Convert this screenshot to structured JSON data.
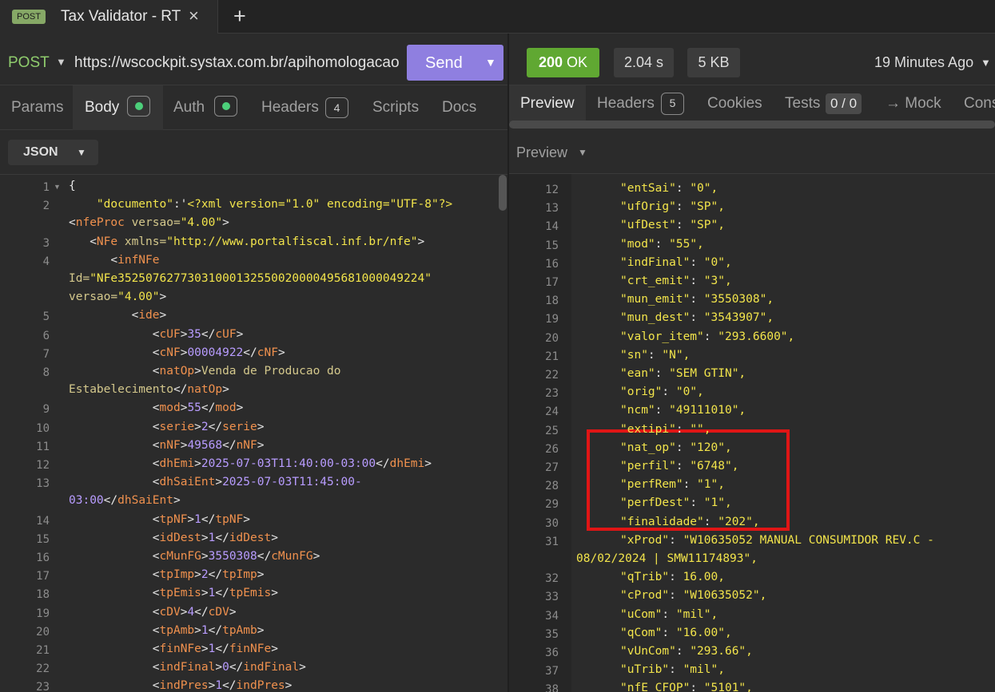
{
  "tab": {
    "method_badge": "POST",
    "title": "Tax Validator - RT",
    "close_icon": "×",
    "add_icon": "+"
  },
  "request": {
    "method": "POST",
    "url": "https://wscockpit.systax.com.br/apihomologacao",
    "send_label": "Send"
  },
  "request_tabs": {
    "params": "Params",
    "body": "Body",
    "auth": "Auth",
    "headers": "Headers",
    "headers_count": "4",
    "scripts": "Scripts",
    "docs": "Docs"
  },
  "body_format": "JSON",
  "editor_lines": [
    {
      "n": "1",
      "segs": [
        [
          "c-bracket",
          "{"
        ]
      ],
      "fold": true
    },
    {
      "n": "2",
      "segs": [
        [
          "c-prop",
          "    \"documento\""
        ],
        [
          "c-bracket",
          ":'"
        ],
        [
          "c-str",
          "<?xml version=\"1.0\" encoding=\"UTF-8\"?>"
        ]
      ]
    },
    {
      "n": "",
      "segs": [
        [
          "c-bracket",
          "<"
        ],
        [
          "c-tag",
          "nfeProc"
        ],
        [
          "c-attr",
          " versao="
        ],
        [
          "c-str",
          "\"4.00\""
        ],
        [
          "c-bracket",
          ">"
        ]
      ]
    },
    {
      "n": "3",
      "segs": [
        [
          "c-bracket",
          "   <"
        ],
        [
          "c-tag",
          "NFe"
        ],
        [
          "c-attr",
          " xmlns="
        ],
        [
          "c-str",
          "\"http://www.portalfiscal.inf.br/nfe\""
        ],
        [
          "c-bracket",
          ">"
        ]
      ]
    },
    {
      "n": "4",
      "segs": [
        [
          "c-bracket",
          "      <"
        ],
        [
          "c-tag",
          "infNFe"
        ]
      ]
    },
    {
      "n": "",
      "segs": [
        [
          "c-attr",
          "Id="
        ],
        [
          "c-str",
          "\"NFe35250762773031000132550020000495681000049224\""
        ]
      ]
    },
    {
      "n": "",
      "segs": [
        [
          "c-attr",
          "versao="
        ],
        [
          "c-str",
          "\"4.00\""
        ],
        [
          "c-bracket",
          ">"
        ]
      ]
    },
    {
      "n": "5",
      "segs": [
        [
          "c-bracket",
          "         <"
        ],
        [
          "c-tag",
          "ide"
        ],
        [
          "c-bracket",
          ">"
        ]
      ]
    },
    {
      "n": "6",
      "segs": [
        [
          "c-bracket",
          "            <"
        ],
        [
          "c-tag",
          "cUF"
        ],
        [
          "c-bracket",
          ">"
        ],
        [
          "c-num",
          "35"
        ],
        [
          "c-bracket",
          "</"
        ],
        [
          "c-tag",
          "cUF"
        ],
        [
          "c-bracket",
          ">"
        ]
      ]
    },
    {
      "n": "7",
      "segs": [
        [
          "c-bracket",
          "            <"
        ],
        [
          "c-tag",
          "cNF"
        ],
        [
          "c-bracket",
          ">"
        ],
        [
          "c-num",
          "00004922"
        ],
        [
          "c-bracket",
          "</"
        ],
        [
          "c-tag",
          "cNF"
        ],
        [
          "c-bracket",
          ">"
        ]
      ]
    },
    {
      "n": "8",
      "segs": [
        [
          "c-bracket",
          "            <"
        ],
        [
          "c-tag",
          "natOp"
        ],
        [
          "c-bracket",
          ">"
        ],
        [
          "c-attr",
          "Venda de Producao do"
        ]
      ]
    },
    {
      "n": "",
      "segs": [
        [
          "c-attr",
          "Estabelecimento"
        ],
        [
          "c-bracket",
          "</"
        ],
        [
          "c-tag",
          "natOp"
        ],
        [
          "c-bracket",
          ">"
        ]
      ]
    },
    {
      "n": "9",
      "segs": [
        [
          "c-bracket",
          "            <"
        ],
        [
          "c-tag",
          "mod"
        ],
        [
          "c-bracket",
          ">"
        ],
        [
          "c-num",
          "55"
        ],
        [
          "c-bracket",
          "</"
        ],
        [
          "c-tag",
          "mod"
        ],
        [
          "c-bracket",
          ">"
        ]
      ]
    },
    {
      "n": "10",
      "segs": [
        [
          "c-bracket",
          "            <"
        ],
        [
          "c-tag",
          "serie"
        ],
        [
          "c-bracket",
          ">"
        ],
        [
          "c-num",
          "2"
        ],
        [
          "c-bracket",
          "</"
        ],
        [
          "c-tag",
          "serie"
        ],
        [
          "c-bracket",
          ">"
        ]
      ]
    },
    {
      "n": "11",
      "segs": [
        [
          "c-bracket",
          "            <"
        ],
        [
          "c-tag",
          "nNF"
        ],
        [
          "c-bracket",
          ">"
        ],
        [
          "c-num",
          "49568"
        ],
        [
          "c-bracket",
          "</"
        ],
        [
          "c-tag",
          "nNF"
        ],
        [
          "c-bracket",
          ">"
        ]
      ]
    },
    {
      "n": "12",
      "segs": [
        [
          "c-bracket",
          "            <"
        ],
        [
          "c-tag",
          "dhEmi"
        ],
        [
          "c-bracket",
          ">"
        ],
        [
          "c-num",
          "2025-07-03T11:40:00-03:00"
        ],
        [
          "c-bracket",
          "</"
        ],
        [
          "c-tag",
          "dhEmi"
        ],
        [
          "c-bracket",
          ">"
        ]
      ]
    },
    {
      "n": "13",
      "segs": [
        [
          "c-bracket",
          "            <"
        ],
        [
          "c-tag",
          "dhSaiEnt"
        ],
        [
          "c-bracket",
          ">"
        ],
        [
          "c-num",
          "2025-07-03T11:45:00-"
        ]
      ]
    },
    {
      "n": "",
      "segs": [
        [
          "c-num",
          "03:00"
        ],
        [
          "c-bracket",
          "</"
        ],
        [
          "c-tag",
          "dhSaiEnt"
        ],
        [
          "c-bracket",
          ">"
        ]
      ]
    },
    {
      "n": "14",
      "segs": [
        [
          "c-bracket",
          "            <"
        ],
        [
          "c-tag",
          "tpNF"
        ],
        [
          "c-bracket",
          ">"
        ],
        [
          "c-num",
          "1"
        ],
        [
          "c-bracket",
          "</"
        ],
        [
          "c-tag",
          "tpNF"
        ],
        [
          "c-bracket",
          ">"
        ]
      ]
    },
    {
      "n": "15",
      "segs": [
        [
          "c-bracket",
          "            <"
        ],
        [
          "c-tag",
          "idDest"
        ],
        [
          "c-bracket",
          ">"
        ],
        [
          "c-num",
          "1"
        ],
        [
          "c-bracket",
          "</"
        ],
        [
          "c-tag",
          "idDest"
        ],
        [
          "c-bracket",
          ">"
        ]
      ]
    },
    {
      "n": "16",
      "segs": [
        [
          "c-bracket",
          "            <"
        ],
        [
          "c-tag",
          "cMunFG"
        ],
        [
          "c-bracket",
          ">"
        ],
        [
          "c-num",
          "3550308"
        ],
        [
          "c-bracket",
          "</"
        ],
        [
          "c-tag",
          "cMunFG"
        ],
        [
          "c-bracket",
          ">"
        ]
      ]
    },
    {
      "n": "17",
      "segs": [
        [
          "c-bracket",
          "            <"
        ],
        [
          "c-tag",
          "tpImp"
        ],
        [
          "c-bracket",
          ">"
        ],
        [
          "c-num",
          "2"
        ],
        [
          "c-bracket",
          "</"
        ],
        [
          "c-tag",
          "tpImp"
        ],
        [
          "c-bracket",
          ">"
        ]
      ]
    },
    {
      "n": "18",
      "segs": [
        [
          "c-bracket",
          "            <"
        ],
        [
          "c-tag",
          "tpEmis"
        ],
        [
          "c-bracket",
          ">"
        ],
        [
          "c-num",
          "1"
        ],
        [
          "c-bracket",
          "</"
        ],
        [
          "c-tag",
          "tpEmis"
        ],
        [
          "c-bracket",
          ">"
        ]
      ]
    },
    {
      "n": "19",
      "segs": [
        [
          "c-bracket",
          "            <"
        ],
        [
          "c-tag",
          "cDV"
        ],
        [
          "c-bracket",
          ">"
        ],
        [
          "c-num",
          "4"
        ],
        [
          "c-bracket",
          "</"
        ],
        [
          "c-tag",
          "cDV"
        ],
        [
          "c-bracket",
          ">"
        ]
      ]
    },
    {
      "n": "20",
      "segs": [
        [
          "c-bracket",
          "            <"
        ],
        [
          "c-tag",
          "tpAmb"
        ],
        [
          "c-bracket",
          ">"
        ],
        [
          "c-num",
          "1"
        ],
        [
          "c-bracket",
          "</"
        ],
        [
          "c-tag",
          "tpAmb"
        ],
        [
          "c-bracket",
          ">"
        ]
      ]
    },
    {
      "n": "21",
      "segs": [
        [
          "c-bracket",
          "            <"
        ],
        [
          "c-tag",
          "finNFe"
        ],
        [
          "c-bracket",
          ">"
        ],
        [
          "c-num",
          "1"
        ],
        [
          "c-bracket",
          "</"
        ],
        [
          "c-tag",
          "finNFe"
        ],
        [
          "c-bracket",
          ">"
        ]
      ]
    },
    {
      "n": "22",
      "segs": [
        [
          "c-bracket",
          "            <"
        ],
        [
          "c-tag",
          "indFinal"
        ],
        [
          "c-bracket",
          ">"
        ],
        [
          "c-num",
          "0"
        ],
        [
          "c-bracket",
          "</"
        ],
        [
          "c-tag",
          "indFinal"
        ],
        [
          "c-bracket",
          ">"
        ]
      ]
    },
    {
      "n": "23",
      "segs": [
        [
          "c-bracket",
          "            <"
        ],
        [
          "c-tag",
          "indPres"
        ],
        [
          "c-bracket",
          ">"
        ],
        [
          "c-num",
          "1"
        ],
        [
          "c-bracket",
          "</"
        ],
        [
          "c-tag",
          "indPres"
        ],
        [
          "c-bracket",
          ">"
        ]
      ]
    }
  ],
  "response": {
    "status": "200",
    "status_text": "OK",
    "time": "2.04 s",
    "size": "5 KB",
    "ago": "19 Minutes Ago"
  },
  "response_tabs": {
    "preview": "Preview",
    "headers": "Headers",
    "headers_count": "5",
    "cookies": "Cookies",
    "tests": "Tests",
    "tests_count": "0 / 0",
    "mock": "→ Mock",
    "console": "Cons"
  },
  "preview_mode": "Preview",
  "viewer_lines": [
    {
      "n": "12",
      "key": "entSai",
      "val": "\"0\","
    },
    {
      "n": "13",
      "key": "ufOrig",
      "val": "\"SP\","
    },
    {
      "n": "14",
      "key": "ufDest",
      "val": "\"SP\","
    },
    {
      "n": "15",
      "key": "mod",
      "val": "\"55\","
    },
    {
      "n": "16",
      "key": "indFinal",
      "val": "\"0\","
    },
    {
      "n": "17",
      "key": "crt_emit",
      "val": "\"3\","
    },
    {
      "n": "18",
      "key": "mun_emit",
      "val": "\"3550308\","
    },
    {
      "n": "19",
      "key": "mun_dest",
      "val": "\"3543907\","
    },
    {
      "n": "20",
      "key": "valor_item",
      "val": "\"293.6600\","
    },
    {
      "n": "21",
      "key": "sn",
      "val": "\"N\","
    },
    {
      "n": "22",
      "key": "ean",
      "val": "\"SEM GTIN\","
    },
    {
      "n": "23",
      "key": "orig",
      "val": "\"0\","
    },
    {
      "n": "24",
      "key": "ncm",
      "val": "\"49111010\","
    },
    {
      "n": "25",
      "key": "extipi",
      "val": "\"\","
    },
    {
      "n": "26",
      "key": "nat_op",
      "val": "\"120\","
    },
    {
      "n": "27",
      "key": "perfil",
      "val": "\"6748\","
    },
    {
      "n": "28",
      "key": "perfRem",
      "val": "\"1\","
    },
    {
      "n": "29",
      "key": "perfDest",
      "val": "\"1\","
    },
    {
      "n": "30",
      "key": "finalidade",
      "val": "\"202\","
    },
    {
      "n": "31",
      "key": "xProd",
      "val": "\"W10635052 MANUAL CONSUMIDOR REV.C -",
      "wrap": "08/02/2024 | SMW11174893\","
    },
    {
      "n": "32",
      "key": "qTrib",
      "val": "16.00,"
    },
    {
      "n": "33",
      "key": "cProd",
      "val": "\"W10635052\","
    },
    {
      "n": "34",
      "key": "uCom",
      "val": "\"mil\","
    },
    {
      "n": "35",
      "key": "qCom",
      "val": "\"16.00\","
    },
    {
      "n": "36",
      "key": "vUnCom",
      "val": "\"293.66\","
    },
    {
      "n": "37",
      "key": "uTrib",
      "val": "\"mil\","
    },
    {
      "n": "38",
      "key": "nfE_CFOP",
      "val": "\"5101\","
    }
  ]
}
